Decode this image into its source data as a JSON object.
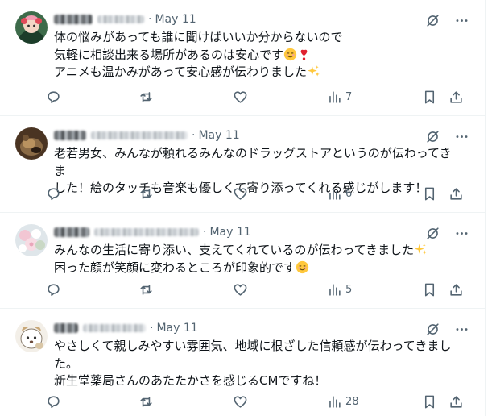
{
  "tweets": [
    {
      "date": "May 11",
      "lines": [
        "体の悩みがあっても誰に聞けばいいか分からないので",
        "気軽に相談出来る場所があるのは安心です",
        "アニメも温かみがあって安心感が伝わりました"
      ],
      "views": "7"
    },
    {
      "date": "May 11",
      "lines": [
        "老若男女、みんなが頼れるみんなのドラッグストアというのが伝わってきま",
        "した！絵のタッチも音楽も優しくて寄り添ってくれる感じがします！"
      ],
      "views": "6"
    },
    {
      "date": "May 11",
      "lines": [
        "みんなの生活に寄り添い、支えてくれているのが伝わってきました",
        "困った顔が笑顔に変わるところが印象的です"
      ],
      "views": "5"
    },
    {
      "date": "May 11",
      "lines": [
        "やさしくて親しみやすい雰囲気、地域に根ざした信頼感が伝わってきまし",
        "た。",
        "新生堂薬局さんのあたたかさを感じるCMですね！"
      ],
      "views": "28"
    }
  ],
  "icons": {
    "reply": "reply-icon",
    "repost": "repost-icon",
    "like": "like-icon",
    "views": "views-icon",
    "bookmark": "bookmark-icon",
    "share": "share-icon",
    "grok": "grok-icon",
    "more": "more-icon"
  },
  "colors": {
    "text": "#0f1419",
    "secondary": "#536471",
    "divider": "#eff3f4"
  }
}
